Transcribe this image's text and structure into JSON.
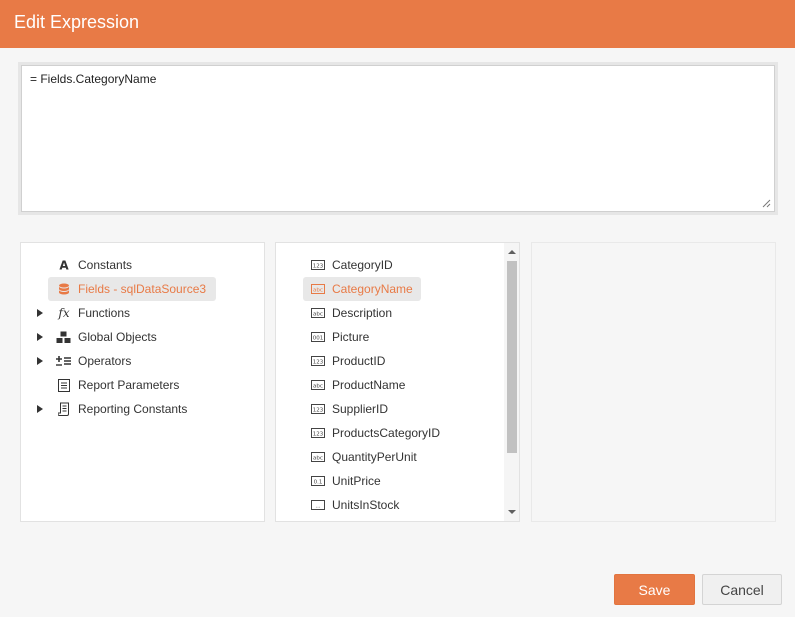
{
  "dialog": {
    "title": "Edit Expression"
  },
  "expression": {
    "value": "= Fields.CategoryName"
  },
  "tree": {
    "items": [
      {
        "label": "Constants",
        "icon": "letter-a-icon",
        "expandable": false,
        "selected": false
      },
      {
        "label": "Fields - sqlDataSource3",
        "icon": "database-icon",
        "expandable": false,
        "selected": true
      },
      {
        "label": "Functions",
        "icon": "fx-icon",
        "expandable": true,
        "selected": false
      },
      {
        "label": "Global Objects",
        "icon": "cubes-icon",
        "expandable": true,
        "selected": false
      },
      {
        "label": "Operators",
        "icon": "operators-icon",
        "expandable": true,
        "selected": false
      },
      {
        "label": "Report Parameters",
        "icon": "parameters-icon",
        "expandable": false,
        "selected": false
      },
      {
        "label": "Reporting Constants",
        "icon": "scroll-icon",
        "expandable": true,
        "selected": false
      }
    ]
  },
  "fields": {
    "items": [
      {
        "label": "CategoryID",
        "type_icon": "123",
        "selected": false
      },
      {
        "label": "CategoryName",
        "type_icon": "abc",
        "selected": true
      },
      {
        "label": "Description",
        "type_icon": "abc",
        "selected": false
      },
      {
        "label": "Picture",
        "type_icon": "001",
        "selected": false
      },
      {
        "label": "ProductID",
        "type_icon": "123",
        "selected": false
      },
      {
        "label": "ProductName",
        "type_icon": "abc",
        "selected": false
      },
      {
        "label": "SupplierID",
        "type_icon": "123",
        "selected": false
      },
      {
        "label": "ProductsCategoryID",
        "type_icon": "123",
        "selected": false
      },
      {
        "label": "QuantityPerUnit",
        "type_icon": "abc",
        "selected": false
      },
      {
        "label": "UnitPrice",
        "type_icon": "0.1",
        "selected": false
      },
      {
        "label": "UnitsInStock",
        "type_icon": "...",
        "selected": false
      }
    ]
  },
  "buttons": {
    "save": "Save",
    "cancel": "Cancel"
  },
  "colors": {
    "accent": "#e87a46",
    "selected_bg": "#e8e8e8"
  }
}
